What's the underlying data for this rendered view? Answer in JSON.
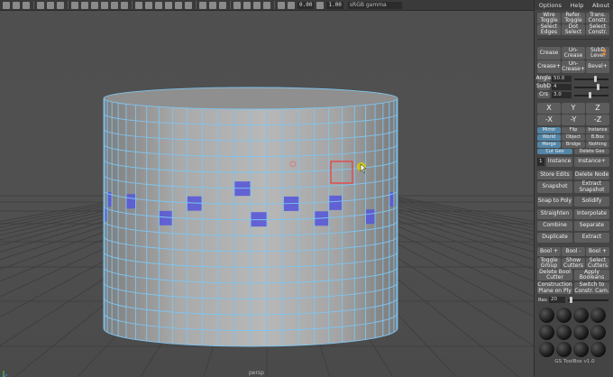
{
  "toolbar": {
    "field1": "0.00",
    "field2": "1.00",
    "colorspace": "sRGB gamma"
  },
  "viewport": {
    "camera_label": "persp"
  },
  "menu": [
    "Options",
    "Help",
    "About"
  ],
  "buttons": {
    "wire_toggle": "Wire Toggle",
    "refer_toggle": "Refer. Toggle",
    "trans_constr": "Trans. Constr.",
    "select_edges": "Select Edges",
    "dot_select": "Dot Select",
    "select_constr": "Select Constr.",
    "crease": "Crease",
    "un_crease": "Un-Crease",
    "subd_level": "SubD Level",
    "crease_plus": "Crease+",
    "un_crease_plus": "Un-Crease+",
    "bevel_plus": "Bevel+",
    "x": "X",
    "y": "Y",
    "z": "Z",
    "nx": "-X",
    "ny": "-Y",
    "nz": "-Z",
    "mirror": "Mirror",
    "flip": "Flip",
    "instance_small": "Instance",
    "world": "World",
    "object": "Object",
    "bbox": "B.Box",
    "merge": "Merge",
    "bridge": "Bridge",
    "nothing": "Nothing",
    "cut_geo": "Cut Geo",
    "delete_geo": "Delete Geo",
    "instance": "Instance",
    "instance_plus": "Instance+",
    "store_edits": "Store Edits",
    "delete_node": "Delete Node",
    "snapshot": "Snapshot",
    "extract_snapshot": "Extract Snapshot",
    "snap_to_poly": "Snap to Poly",
    "solidify": "Solidify",
    "straighten": "Straighten",
    "interpolate": "Interpolate",
    "combine": "Combine",
    "separate": "Separate",
    "duplicate": "Duplicate",
    "extract": "Extract",
    "bool_plus": "Bool +",
    "bool_minus": "Bool -",
    "bool_plus2": "Bool +",
    "toggle_group": "Toggle Group",
    "show_cutters": "Show Cutters",
    "select_cutters": "Select Cutters",
    "delete_bool_cutter": "Delete Bool Cutter",
    "apply_booleans": "Apply Booleans",
    "construction_plane": "Construction Plane on Ply",
    "switch_constr_cam": "Switch to Constr. Cam."
  },
  "sliders": {
    "angle_label": "Angle",
    "angle_value": "50.0",
    "subd_label": "SubD",
    "subd_value": "4",
    "crs_label": "Crs",
    "crs_value": "3.0",
    "res_label": "Res",
    "res_value": "20"
  },
  "panel": {
    "instance_count": "1",
    "subd_badge": "2",
    "footer": "GS ToolBox v1.0"
  },
  "colors": {
    "wire": "#7fc4ee",
    "selected_face": "#5a5ad8",
    "highlight": "#e64848",
    "cursor": "#d8d000",
    "toggle_blue": "#5285a6"
  }
}
